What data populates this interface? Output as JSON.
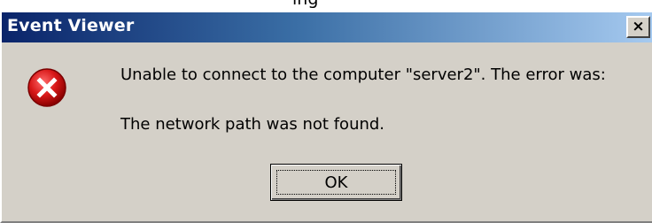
{
  "window": {
    "title": "Event Viewer",
    "close_glyph": "×",
    "obscured_text_above": "ing"
  },
  "dialog": {
    "icon": "error-icon",
    "message_line_1": "Unable to connect to the computer \"server2\".  The error was:",
    "message_line_2": "The network path was not found.",
    "ok_label": "OK"
  },
  "colors": {
    "title_bar_start": "#0a246a",
    "title_bar_end": "#a6caf0",
    "dialog_face": "#d4d0c8",
    "error_red": "#cc1111"
  }
}
